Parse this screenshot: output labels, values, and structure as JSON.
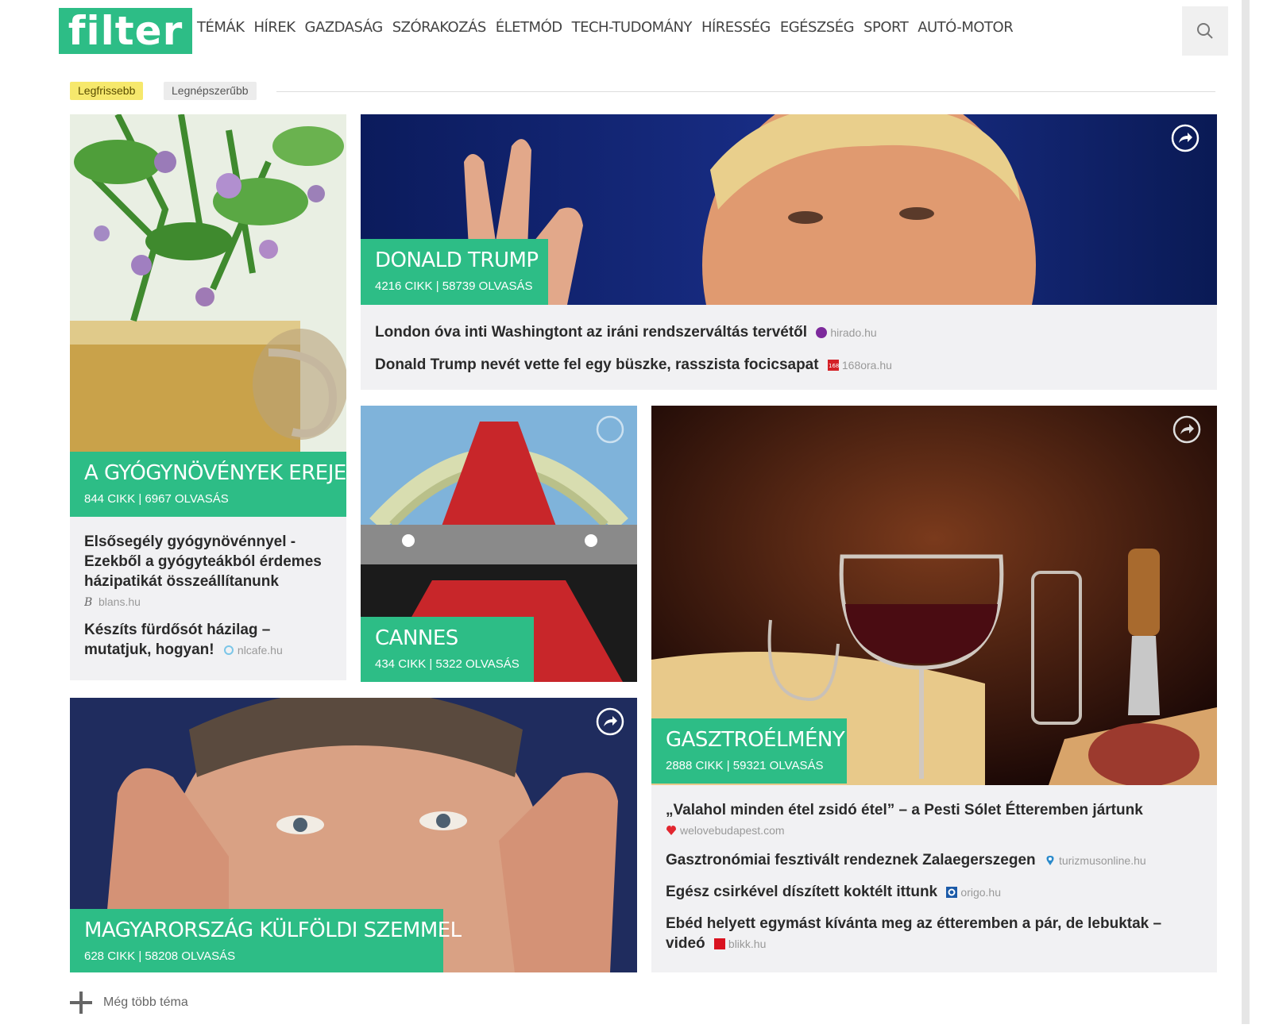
{
  "header": {
    "logo": "filter",
    "nav": [
      "TÉMÁK",
      "HÍREK",
      "GAZDASÁG",
      "SZÓRAKOZÁS",
      "ÉLETMÓD",
      "TECH-TUDOMÁNY",
      "HÍRESSÉG",
      "EGÉSZSÉG",
      "SPORT",
      "AUTÓ-MOTOR"
    ],
    "search_icon": "search-icon"
  },
  "tabs": {
    "newest": "Legfrissebb",
    "popular": "Legnépszerűbb"
  },
  "cards": {
    "trump": {
      "title": "DONALD TRUMP",
      "stats": "4216 CIKK | 58739 OLVASÁS",
      "articles": [
        {
          "title": "London óva inti Washingtont az iráni rendszerváltás tervétől",
          "source": "hirado.hu"
        },
        {
          "title": "Donald Trump nevét vette fel egy büszke, rasszista focicsapat",
          "source": "168ora.hu"
        }
      ]
    },
    "herbs": {
      "title": "A GYÓGYNÖVÉNYEK EREJE",
      "stats": "844 CIKK | 6967 OLVASÁS",
      "articles": [
        {
          "title": "Elsősegély gyógynövénnyel - Ezekből a gyógyteákból érdemes házipatikát összeállítanunk",
          "source": "blans.hu"
        },
        {
          "title": "Készíts fürdősót házilag – mutatjuk, hogyan!",
          "source": "nlcafe.hu"
        }
      ]
    },
    "cannes": {
      "title": "CANNES",
      "stats": "434 CIKK | 5322 OLVASÁS"
    },
    "gastro": {
      "title": "GASZTROÉLMÉNY",
      "stats": "2888 CIKK | 59321 OLVASÁS",
      "articles": [
        {
          "title": "„Valahol minden étel zsidó étel” – a Pesti Sólet Étteremben jártunk",
          "source": "welovebudapest.com"
        },
        {
          "title": "Gasztronómiai fesztivált rendeznek Zalaegerszegen",
          "source": "turizmusonline.hu"
        },
        {
          "title": "Egész csirkével díszített koktélt ittunk",
          "source": "origo.hu"
        },
        {
          "title": "Ebéd helyett egymást kívánta meg az étteremben a pár, de lebuktak – videó",
          "source": "blikk.hu"
        }
      ]
    },
    "hungary": {
      "title": "MAGYARORSZÁG KÜLFÖLDI SZEMMEL",
      "stats": "628 CIKK | 58208 OLVASÁS"
    }
  },
  "more_topics": "Még több téma",
  "colors": {
    "accent": "#2dbd86",
    "tab_active": "#f6e86c"
  }
}
